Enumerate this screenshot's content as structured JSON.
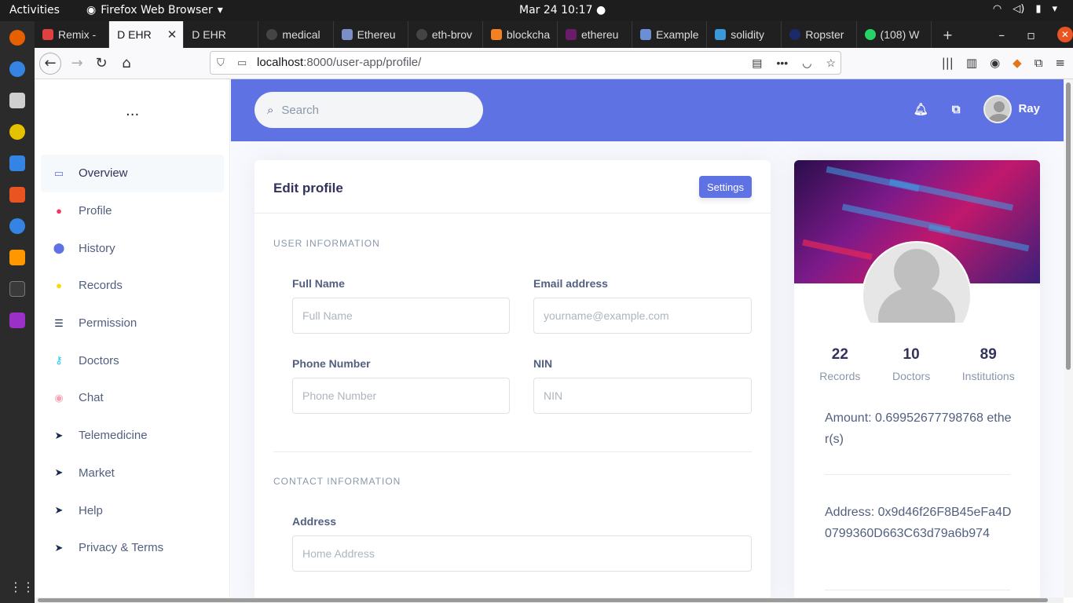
{
  "system": {
    "activities": "Activities",
    "app_name": "Firefox Web Browser",
    "clock": "Mar 24  10:17"
  },
  "tabs": [
    {
      "label": "Remix -",
      "color": "#e04040"
    },
    {
      "label": "D EHR",
      "color": "#f9f9fb"
    },
    {
      "label": "D EHR",
      "color": "#444"
    },
    {
      "label": "medical",
      "color": "#444"
    },
    {
      "label": "Ethereu",
      "color": "#7b8ec8"
    },
    {
      "label": "eth-brov",
      "color": "#444"
    },
    {
      "label": "blockcha",
      "color": "#f48024"
    },
    {
      "label": "ethereu",
      "color": "#6a1b6a"
    },
    {
      "label": "Example",
      "color": "#6b8fd6"
    },
    {
      "label": "solidity",
      "color": "#3a9ad9"
    },
    {
      "label": "Ropster",
      "color": "#1a2a6a"
    },
    {
      "label": "(108) W",
      "color": "#25d366"
    }
  ],
  "browser": {
    "url_host": "localhost",
    "url_rest": ":8000/user-app/profile/"
  },
  "sidebar": {
    "dots": "...",
    "items": [
      {
        "label": "Overview",
        "icon": "desktop-icon",
        "color": "#5e72e4"
      },
      {
        "label": "Profile",
        "icon": "planet-icon",
        "color": "#f5365c"
      },
      {
        "label": "History",
        "icon": "pin-icon",
        "color": "#5e72e4"
      },
      {
        "label": "Records",
        "icon": "user-icon",
        "color": "#ffd600"
      },
      {
        "label": "Permission",
        "icon": "list-icon",
        "color": "#172b4d"
      },
      {
        "label": "Doctors",
        "icon": "key-icon",
        "color": "#11cdef"
      },
      {
        "label": "Chat",
        "icon": "user-circle-icon",
        "color": "#f3a4b5"
      },
      {
        "label": "Telemedicine",
        "icon": "send-icon",
        "color": "#172b4d"
      },
      {
        "label": "Market",
        "icon": "send-icon",
        "color": "#172b4d"
      },
      {
        "label": "Help",
        "icon": "send-icon",
        "color": "#172b4d"
      },
      {
        "label": "Privacy & Terms",
        "icon": "send-icon",
        "color": "#172b4d"
      }
    ]
  },
  "header": {
    "search_placeholder": "Search",
    "user_name": "Ray"
  },
  "form": {
    "title": "Edit profile",
    "settings_label": "Settings",
    "section_user": "USER INFORMATION",
    "full_name_label": "Full Name",
    "full_name_placeholder": "Full Name",
    "email_label": "Email address",
    "email_placeholder": "yourname@example.com",
    "phone_label": "Phone Number",
    "phone_placeholder": "Phone Number",
    "nin_label": "NIN",
    "nin_placeholder": "NIN",
    "section_contact": "CONTACT INFORMATION",
    "address_label": "Address",
    "address_placeholder": "Home Address"
  },
  "profile_card": {
    "stats": [
      {
        "value": "22",
        "label": "Records"
      },
      {
        "value": "10",
        "label": "Doctors"
      },
      {
        "value": "89",
        "label": "Institutions"
      }
    ],
    "amount": "Amount: 0.69952677798768 ether(s)",
    "address": "Address: 0x9d46f26F8B45eFa4D0799360D663C63d79a6b974"
  }
}
